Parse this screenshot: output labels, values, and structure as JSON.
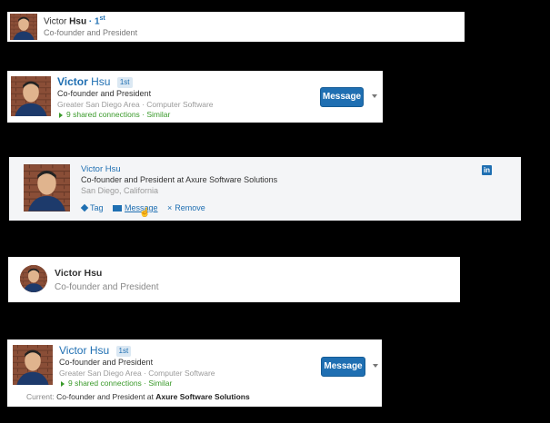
{
  "person": {
    "first_name": "Victor",
    "last_name": "Hsu",
    "full_name": "Victor Hsu",
    "title": "Co-founder and President"
  },
  "card1": {
    "degree": " · 1",
    "degree_sup": "st"
  },
  "card2": {
    "degree": "1st",
    "location_industry": "Greater San Diego Area · Computer Software",
    "shared": "9 shared connections · Similar",
    "message_label": "Message"
  },
  "card3": {
    "headline": "Co-founder and President at Axure Software Solutions",
    "location": "San Diego, California",
    "tag_label": "Tag",
    "message_label": "Message",
    "remove_label": "Remove",
    "brand_icon": "in"
  },
  "card5": {
    "degree": "1st",
    "location_industry": "Greater San Diego Area · Computer Software",
    "shared": "9 shared connections · Similar",
    "message_label": "Message",
    "current_label": "Current:",
    "current_text": "Co-founder and President at ",
    "current_company": "Axure Software Solutions"
  },
  "colors": {
    "brand_blue": "#1f6fb2",
    "green": "#3a9a2a"
  }
}
